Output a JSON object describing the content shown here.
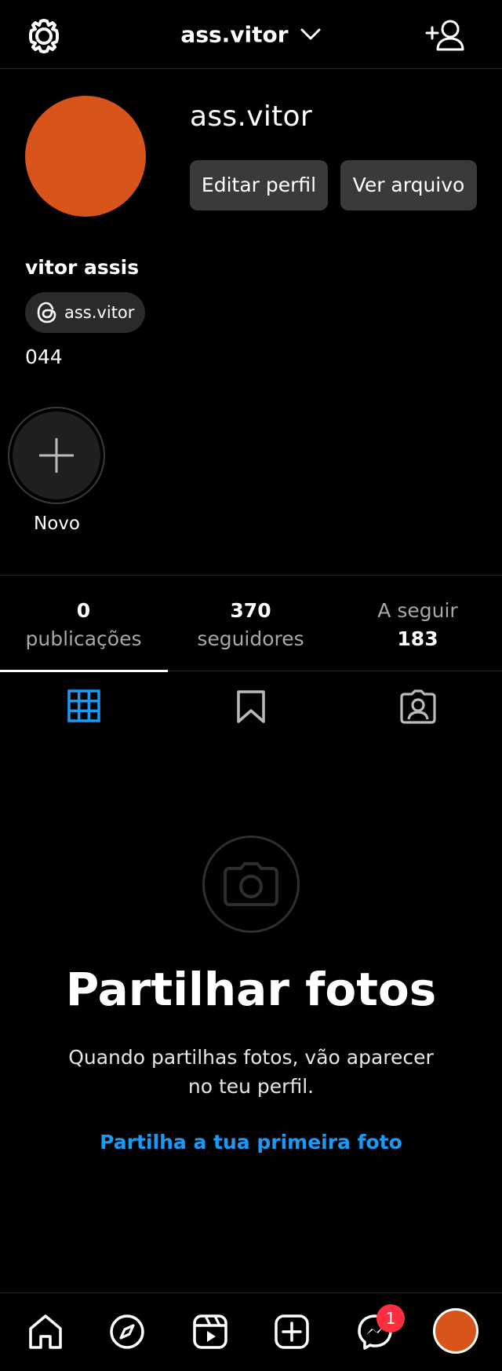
{
  "header": {
    "account_name": "ass.vitor",
    "icons": [
      "settings-icon",
      "chevron-down-icon",
      "add-person-icon"
    ]
  },
  "profile": {
    "username": "ass.vitor",
    "edit_button": "Editar perfil",
    "archive_button": "Ver arquivo",
    "full_name": "vitor assis",
    "threads_handle": "ass.vitor",
    "bio": "044",
    "avatar_color": "#d9541a"
  },
  "highlight": {
    "new_label": "Novo"
  },
  "stats": {
    "posts": {
      "count": "0",
      "label": "publicações"
    },
    "followers": {
      "count": "370",
      "label": "seguidores"
    },
    "following": {
      "label": "A seguir",
      "count": "183"
    }
  },
  "tabs": [
    "grid-icon",
    "saved-icon",
    "tagged-icon"
  ],
  "empty_state": {
    "title": "Partilhar fotos",
    "description": "Quando partilhas fotos, vão aparecer no teu perfil.",
    "link": "Partilha a tua primeira foto"
  },
  "bottom_nav": {
    "items": [
      "home-icon",
      "explore-icon",
      "reels-icon",
      "create-icon",
      "messenger-icon",
      "profile-avatar"
    ],
    "messenger_badge": "1"
  },
  "colors": {
    "accent_blue": "#1a9af5",
    "badge_red": "#ff2f40",
    "button_bg": "#3a3a3a"
  }
}
